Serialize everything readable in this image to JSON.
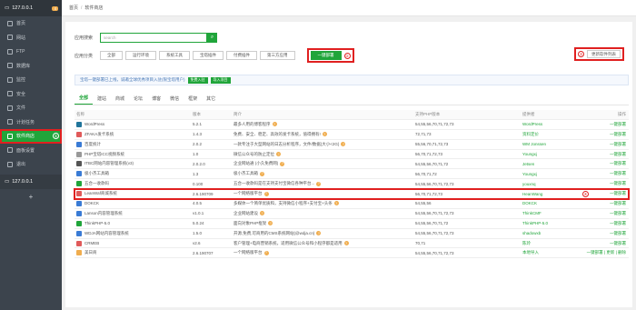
{
  "sidebar": {
    "host": "127.0.0.1",
    "host_badge": "4",
    "items": [
      {
        "label": "首页",
        "icon": "home-icon"
      },
      {
        "label": "网站",
        "icon": "globe-icon"
      },
      {
        "label": "FTP",
        "icon": "ftp-icon"
      },
      {
        "label": "数据库",
        "icon": "database-icon"
      },
      {
        "label": "监控",
        "icon": "monitor-icon"
      },
      {
        "label": "安全",
        "icon": "shield-icon"
      },
      {
        "label": "文件",
        "icon": "folder-icon"
      },
      {
        "label": "计划任务",
        "icon": "clock-icon"
      },
      {
        "label": "软件商店",
        "icon": "store-icon",
        "active": true,
        "marker": "①"
      },
      {
        "label": "面板设置",
        "icon": "settings-icon"
      },
      {
        "label": "退出",
        "icon": "logout-icon"
      }
    ],
    "host2": "127.0.0.1",
    "add": "+"
  },
  "breadcrumb": {
    "home": "首页",
    "sep": "/",
    "current": "软件商店"
  },
  "search": {
    "label": "应用搜索",
    "placeholder": "search"
  },
  "category": {
    "label": "应用分类",
    "buttons": [
      "全部",
      "运行环境",
      "系统工具",
      "宝塔插件",
      "付费插件",
      "第三方应用"
    ],
    "one_click": "一键部署",
    "marker2": "②",
    "marker3": "③",
    "update_list": "更新软件列表"
  },
  "notice": {
    "text": "宝塔一键部署已上线，诚邀全球优秀项目入驻(限宝塔用户)",
    "btn1": "免费入驻",
    "btn2": "导入项目"
  },
  "tabs": [
    "全部",
    "建站",
    "商城",
    "论坛",
    "博客",
    "微信",
    "框架",
    "其它"
  ],
  "table": {
    "headers": {
      "name": "名称",
      "ver": "版本",
      "desc": "简介",
      "php": "支持PHP版本",
      "prov": "提供者",
      "op": "操作"
    },
    "rows": [
      {
        "name": "WordPress",
        "ver": "5.2.1",
        "desc": "最多人用的博客程序",
        "php": "54,55,56,70,71,72,73",
        "prov": "WordPress",
        "op": "一键部署",
        "color": "#21759b"
      },
      {
        "name": "ZFAKA发卡系统",
        "ver": "1.4.3",
        "desc": "免费、安全、稳定、高效的发卡系统，值得拥有!",
        "php": "72,71,73",
        "prov": "资料定价",
        "op": "一键部署",
        "color": "#e05a5a"
      },
      {
        "name": "百度统计",
        "ver": "2.0.2",
        "desc": "一款专注于大型网站的日志分析程序，文件/数据(大小<2G)",
        "php": "55,56,70,71,72,73",
        "prov": "WM Jonssen",
        "op": "一键部署",
        "color": "#3a7bd5"
      },
      {
        "name": "PHP宝塔ICC视频系统",
        "ver": "1.0",
        "desc": "微信公众号的防止定位",
        "php": "56,70,71,72,73",
        "prov": "Youngxj",
        "op": "一键部署",
        "color": "#999999"
      },
      {
        "name": "ITBC网站内容管理系统(v3)",
        "ver": "2.0.2.0",
        "desc": "企业网站通 (小久免费网)",
        "php": "54,55,56,70,71,72",
        "prov": "Jetsen",
        "op": "一键部署",
        "color": "#555555"
      },
      {
        "name": "极小杰工具箱",
        "ver": "1.3",
        "desc": "极小杰工具箱",
        "php": "56,70,71,72",
        "prov": "Youngxj",
        "op": "一键部署",
        "color": "#3a7bd5"
      },
      {
        "name": "五合一收款码",
        "ver": "0.100",
        "desc": "五合一收款码是在支持支付宝微信各种平台...",
        "php": "54,55,56,70,71,72,73",
        "prov": "youxnq",
        "op": "一键部署",
        "color": "#20a53a"
      },
      {
        "name": "LeanWaf商城系统",
        "ver": "2.6.190709",
        "desc": "一个网络版平台",
        "php": "56,70,71,72,73",
        "prov": "HeanWang",
        "op": "一键部署",
        "color": "#e05a5a",
        "hl": true,
        "marker": "④"
      },
      {
        "name": "DOKCK",
        "ver": "4.0.5",
        "desc": "多媒体一个简单优质和，支持微信小程序+支付宝+头条",
        "php": "54,55,56",
        "prov": "DOKCK",
        "op": "一键部署",
        "color": "#3a7bd5"
      },
      {
        "name": "Lanson内容管理系统",
        "ver": "v1.0.1",
        "desc": "企业网站建设",
        "php": "54,55,56,70,71,72,73",
        "prov": "ThinkCMF",
        "op": "一键部署",
        "color": "#3a7bd5"
      },
      {
        "name": "ThinkPHP-5.0",
        "ver": "5.0.24",
        "desc": "面向对象PHP框架",
        "php": "54,55,56,70,71,72",
        "prov": "ThinkPHP-5.0",
        "op": "一键部署",
        "color": "#20a53a"
      },
      {
        "name": "WDJA网站内容管理系统",
        "ver": "1.5.0",
        "desc": "开源,免费,可商用的CMS系统网站(@wdja.cn)",
        "php": "54,55,56,70,71,72,73",
        "prov": "shadowxb",
        "op": "一键部署",
        "color": "#3a7bd5"
      },
      {
        "name": "CRMEB",
        "ver": "v2.6",
        "desc": "客户管理+电商营销系统，适用微信公众号和小程序都是适用",
        "php": "70,71",
        "prov": "陈玲",
        "op": "一键部署",
        "color": "#e05a5a"
      },
      {
        "name": "美日商",
        "ver": "2.6.190707",
        "desc": "一个网络版平台",
        "php": "54,55,56,70,71,72,73",
        "prov": "本地导入",
        "op": "一键部署 | 更新 | 删除",
        "color": "#f0ad4e"
      }
    ]
  }
}
